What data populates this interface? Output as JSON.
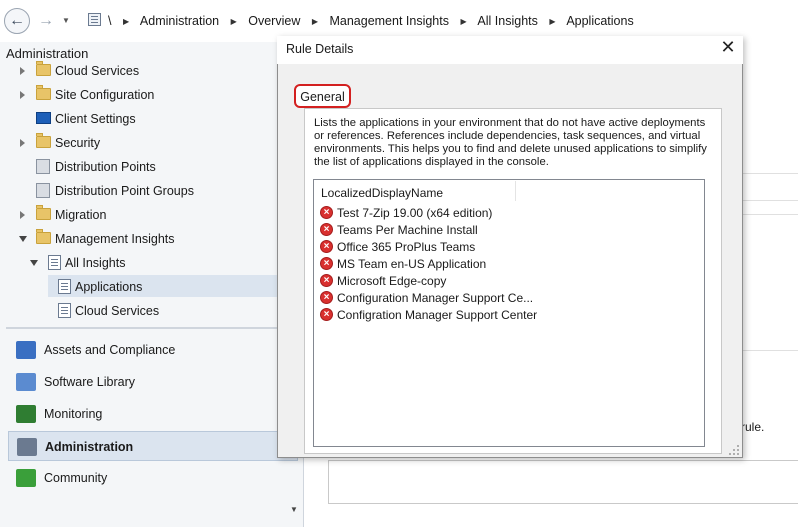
{
  "breadcrumb": {
    "root": "\\",
    "items": [
      "Administration",
      "Overview",
      "Management Insights",
      "All Insights",
      "Applications"
    ]
  },
  "nav": {
    "title": "Administration",
    "tree": [
      {
        "label": "Cloud Services",
        "icon": "folder-icon"
      },
      {
        "label": "Site Configuration",
        "icon": "folder-icon"
      },
      {
        "label": "Client Settings",
        "icon": "client-settings-icon"
      },
      {
        "label": "Security",
        "icon": "folder-icon"
      },
      {
        "label": "Distribution Points",
        "icon": "server-icon"
      },
      {
        "label": "Distribution Point Groups",
        "icon": "server-group-icon"
      },
      {
        "label": "Migration",
        "icon": "folder-icon"
      },
      {
        "label": "Management Insights",
        "icon": "folder-icon"
      },
      {
        "label": "All Insights",
        "icon": "list-icon"
      },
      {
        "label": "Applications",
        "icon": "list-icon"
      },
      {
        "label": "Cloud Services",
        "icon": "list-icon"
      }
    ],
    "workspaces": [
      {
        "label": "Assets and Compliance",
        "icon": "assets-icon",
        "color": "#3a6fc2"
      },
      {
        "label": "Software Library",
        "icon": "software-library-icon",
        "color": "#5b8bd0"
      },
      {
        "label": "Monitoring",
        "icon": "monitoring-icon",
        "color": "#2f7d32"
      },
      {
        "label": "Administration",
        "icon": "administration-icon",
        "color": "#6b7a90"
      },
      {
        "label": "Community",
        "icon": "community-icon",
        "color": "#3a9f3a"
      }
    ]
  },
  "background": {
    "partial_text": "rule."
  },
  "dialog": {
    "title": "Rule Details",
    "tab": "General",
    "description": "Lists the applications in your environment that do not have active deployments or references. References include dependencies, task sequences, and virtual environments. This helps you to find and delete unused applications to simplify the list of applications displayed in the console.",
    "column_header": "LocalizedDisplayName",
    "items": [
      "Test 7-Zip 19.00 (x64 edition)",
      "Teams Per Machine Install",
      "Office 365 ProPlus Teams",
      "MS Team en-US Application",
      "Microsoft Edge-copy",
      "Configuration Manager Support Ce...",
      "Configration Manager Support Center"
    ],
    "accent_color": "#d32020"
  }
}
